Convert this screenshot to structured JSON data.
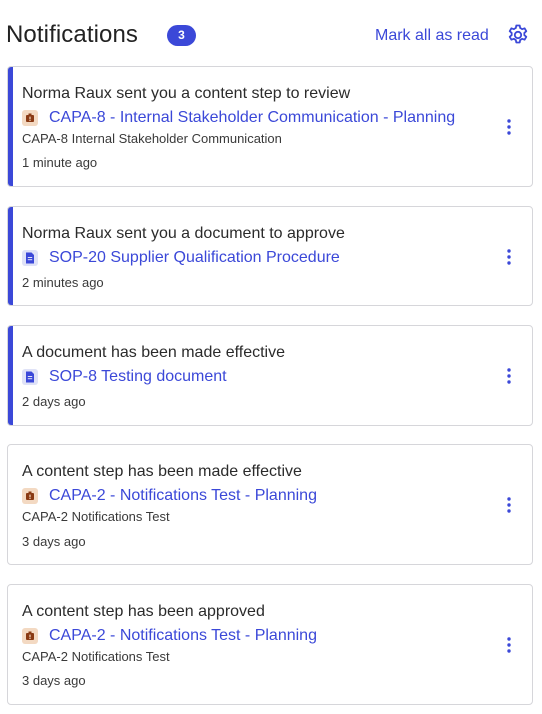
{
  "header": {
    "title": "Notifications",
    "count": "3",
    "mark_all": "Mark all as read"
  },
  "colors": {
    "accent": "#3b48d8",
    "capa_icon_bg": "#f3d9c2",
    "capa_icon_fg": "#8a3a14",
    "doc_icon_bg": "#dfe2f7"
  },
  "notifications": [
    {
      "unread": true,
      "message": "Norma Raux sent you a content step to review",
      "item_type": "capa",
      "link": "CAPA-8 - Internal Stakeholder Communication - Planning",
      "subtitle": "CAPA-8 Internal Stakeholder Communication",
      "time": "1 minute ago"
    },
    {
      "unread": true,
      "message": "Norma Raux sent you a document to approve",
      "item_type": "document",
      "link": "SOP-20 Supplier Qualification Procedure",
      "subtitle": "",
      "time": "2 minutes ago"
    },
    {
      "unread": true,
      "message": "A document has been made effective",
      "item_type": "document",
      "link": "SOP-8 Testing document",
      "subtitle": "",
      "time": "2 days ago"
    },
    {
      "unread": false,
      "message": "A content step has been made effective",
      "item_type": "capa",
      "link": "CAPA-2 - Notifications Test - Planning",
      "subtitle": "CAPA-2 Notifications Test",
      "time": "3 days ago"
    },
    {
      "unread": false,
      "message": "A content step has been approved",
      "item_type": "capa",
      "link": "CAPA-2 - Notifications Test - Planning",
      "subtitle": "CAPA-2 Notifications Test",
      "time": "3 days ago"
    }
  ]
}
